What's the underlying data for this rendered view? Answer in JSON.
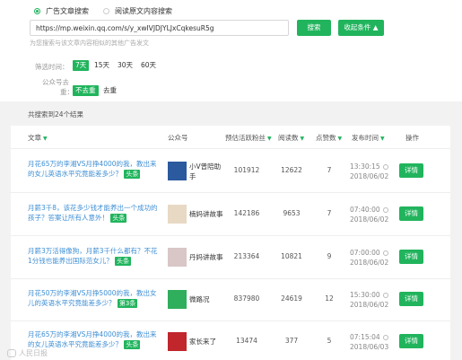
{
  "search": {
    "modes": [
      {
        "label": "广告文章搜索",
        "selected": true
      },
      {
        "label": "阅读原文内容搜索",
        "selected": false
      }
    ],
    "url_value": "https://mp.weixin.qq.com/s/y_xwIVJDJYLJxCqkesuR5g",
    "search_button": "搜索",
    "conditions_button": "收起条件 ▲",
    "hint": "为您搜索与该文章内容相似的其他广告发文"
  },
  "filters": {
    "time_label": "筛选时间：",
    "time_options": [
      "7天",
      "15天",
      "30天",
      "60天"
    ],
    "time_selected": "7天",
    "dedupe_label_line1": "公众号去",
    "dedupe_label_line2": "重：",
    "dedupe_options": [
      "不去重",
      "去重"
    ],
    "dedupe_selected": "不去重"
  },
  "results": {
    "count_text": "共搜索到24个结果",
    "headers": {
      "article": "文章",
      "account": "公众号",
      "fans": "预估活跃粉丝",
      "reads": "阅读数",
      "likes": "点赞数",
      "time": "发布时间",
      "action": "操作"
    },
    "rows": [
      {
        "title": "月花65万的李湘VS月挣4000的我，教出来的女儿英语水平究竟能差多少？",
        "tag": "头条",
        "account": "小V曾陪助手",
        "fans": "101912",
        "reads": "12622",
        "likes": "7",
        "time": "13:30:15",
        "date": "2018/06/02",
        "action": "详情",
        "avatar_color": "#2b5a9e"
      },
      {
        "title": "月薪3千8，该花多少钱才能养出一个成功的孩子？答案让所有人意外！",
        "tag": "头条",
        "account": "楠妈讲故事",
        "fans": "142186",
        "reads": "9653",
        "likes": "7",
        "time": "07:40:00",
        "date": "2018/06/02",
        "action": "详情",
        "avatar_color": "#e8d9c4"
      },
      {
        "title": "月薪3万活得像狗，月薪3千什么都有？不花1分钱也能养出国际范女儿？",
        "tag": "头条",
        "account": "丹妈讲故事",
        "fans": "213364",
        "reads": "10821",
        "likes": "9",
        "time": "07:00:00",
        "date": "2018/06/02",
        "action": "详情",
        "avatar_color": "#d9c6c6"
      },
      {
        "title": "月花50万的李湘VS月挣5000的我，教出女儿的英语水平究竟能差多少？",
        "tag": "第3条",
        "account": "微路况",
        "fans": "837980",
        "reads": "24619",
        "likes": "12",
        "time": "15:30:00",
        "date": "2018/06/02",
        "action": "详情",
        "avatar_color": "#2fae5c"
      },
      {
        "title": "月花65万的李湘VS月挣4000的我，教出来的女儿英语水平究竟能差多少？",
        "tag": "头条",
        "account": "家长来了",
        "fans": "13474",
        "reads": "377",
        "likes": "5",
        "time": "07:15:04",
        "date": "2018/06/03",
        "action": "详情",
        "avatar_color": "#c0262c"
      }
    ]
  },
  "watermark": "人民日报"
}
